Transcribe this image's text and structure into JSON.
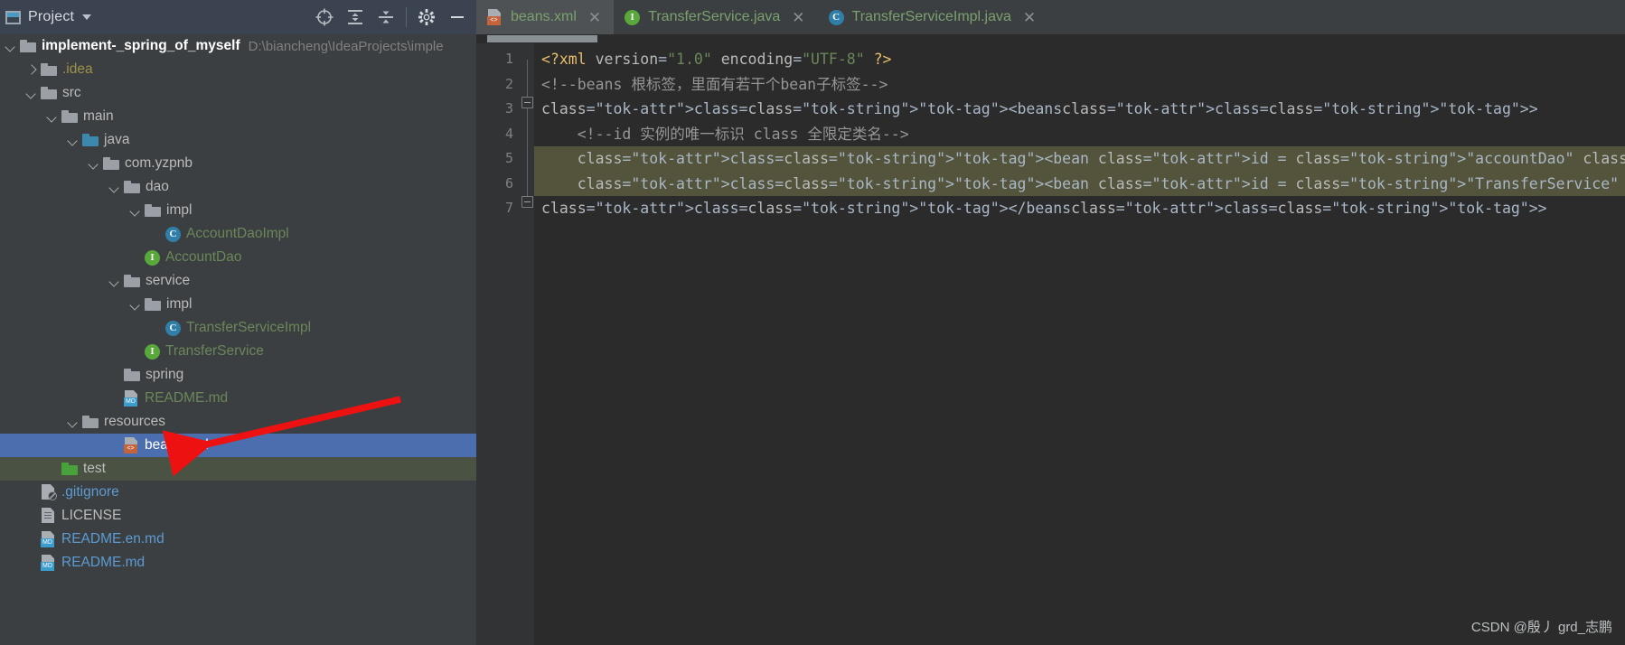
{
  "window": {
    "watermark": "CSDN @殷丿 grd_志鹏"
  },
  "project_panel": {
    "title": "Project",
    "title_icon": "project-panel-icon",
    "caret_icon": "chevron-down-icon",
    "toolbar": [
      {
        "name": "locate-icon",
        "label": ""
      },
      {
        "name": "expand-all-icon",
        "label": ""
      },
      {
        "name": "collapse-all-icon",
        "label": ""
      },
      {
        "name": "settings-gear-icon",
        "label": ""
      },
      {
        "name": "hide-panel-icon",
        "label": ""
      }
    ]
  },
  "tree": [
    {
      "label": "implement-_spring_of_myself",
      "path": "D:\\biancheng\\IdeaProjects\\imple",
      "indent": 0,
      "arrow": "down",
      "icon": "module-folder",
      "color": "white",
      "bold": true,
      "name": "tree-item-project-root"
    },
    {
      "label": ".idea",
      "path": "",
      "indent": 1,
      "arrow": "right",
      "icon": "folder-grey",
      "color": "yellow",
      "bold": false,
      "name": "tree-item-idea"
    },
    {
      "label": "src",
      "path": "",
      "indent": 1,
      "arrow": "down",
      "icon": "folder-grey",
      "color": "grey",
      "bold": false,
      "name": "tree-item-src"
    },
    {
      "label": "main",
      "path": "",
      "indent": 2,
      "arrow": "down",
      "icon": "folder-grey",
      "color": "grey",
      "bold": false,
      "name": "tree-item-main"
    },
    {
      "label": "java",
      "path": "",
      "indent": 3,
      "arrow": "down",
      "icon": "folder-blue",
      "color": "grey",
      "bold": false,
      "name": "tree-item-java"
    },
    {
      "label": "com.yzpnb",
      "path": "",
      "indent": 4,
      "arrow": "down",
      "icon": "folder-package",
      "color": "grey",
      "bold": false,
      "name": "tree-item-com-yzpnb"
    },
    {
      "label": "dao",
      "path": "",
      "indent": 5,
      "arrow": "down",
      "icon": "folder-package",
      "color": "grey",
      "bold": false,
      "name": "tree-item-dao"
    },
    {
      "label": "impl",
      "path": "",
      "indent": 6,
      "arrow": "down",
      "icon": "folder-package",
      "color": "grey",
      "bold": false,
      "name": "tree-item-dao-impl"
    },
    {
      "label": "AccountDaoImpl",
      "path": "",
      "indent": 7,
      "arrow": "none",
      "icon": "class-icon",
      "color": "green",
      "bold": false,
      "name": "tree-item-accountdaoimpl"
    },
    {
      "label": "AccountDao",
      "path": "",
      "indent": 6,
      "arrow": "none",
      "icon": "interface-icon",
      "color": "green",
      "bold": false,
      "name": "tree-item-accountdao"
    },
    {
      "label": "service",
      "path": "",
      "indent": 5,
      "arrow": "down",
      "icon": "folder-package",
      "color": "grey",
      "bold": false,
      "name": "tree-item-service"
    },
    {
      "label": "impl",
      "path": "",
      "indent": 6,
      "arrow": "down",
      "icon": "folder-package",
      "color": "grey",
      "bold": false,
      "name": "tree-item-service-impl"
    },
    {
      "label": "TransferServiceImpl",
      "path": "",
      "indent": 7,
      "arrow": "none",
      "icon": "class-icon",
      "color": "green",
      "bold": false,
      "name": "tree-item-transferserviceimpl"
    },
    {
      "label": "TransferService",
      "path": "",
      "indent": 6,
      "arrow": "none",
      "icon": "interface-icon",
      "color": "green",
      "bold": false,
      "name": "tree-item-transferservice"
    },
    {
      "label": "spring",
      "path": "",
      "indent": 5,
      "arrow": "none",
      "icon": "folder-package",
      "color": "grey",
      "bold": false,
      "name": "tree-item-spring"
    },
    {
      "label": "README.md",
      "path": "",
      "indent": 5,
      "arrow": "none",
      "icon": "markdown-icon",
      "color": "green",
      "bold": false,
      "name": "tree-item-readme-md-inner"
    },
    {
      "label": "resources",
      "path": "",
      "indent": 3,
      "arrow": "down",
      "icon": "folder-resources",
      "color": "grey",
      "bold": false,
      "name": "tree-item-resources"
    },
    {
      "label": "beans.xml",
      "path": "",
      "indent": 5,
      "arrow": "none",
      "icon": "xml-icon",
      "color": "white",
      "bold": false,
      "selected": true,
      "name": "tree-item-beans-xml"
    },
    {
      "label": "test",
      "path": "",
      "indent": 2,
      "arrow": "none",
      "icon": "folder-green",
      "color": "grey",
      "bold": false,
      "testscope": true,
      "name": "tree-item-test"
    },
    {
      "label": ".gitignore",
      "path": "",
      "indent": 1,
      "arrow": "none",
      "icon": "gitignore-icon",
      "color": "blue",
      "bold": false,
      "name": "tree-item-gitignore"
    },
    {
      "label": "LICENSE",
      "path": "",
      "indent": 1,
      "arrow": "none",
      "icon": "text-file-icon",
      "color": "grey",
      "bold": false,
      "name": "tree-item-license"
    },
    {
      "label": "README.en.md",
      "path": "",
      "indent": 1,
      "arrow": "none",
      "icon": "markdown-icon",
      "color": "blue",
      "bold": false,
      "name": "tree-item-readme-en-md"
    },
    {
      "label": "README.md",
      "path": "",
      "indent": 1,
      "arrow": "none",
      "icon": "markdown-icon",
      "color": "blue",
      "bold": false,
      "name": "tree-item-readme-md"
    }
  ],
  "tabs": [
    {
      "label": "beans.xml",
      "icon": "xml-icon",
      "active": true,
      "close": "✕",
      "name": "tab-beans-xml"
    },
    {
      "label": "TransferService.java",
      "icon": "interface-icon",
      "active": false,
      "close": "✕",
      "name": "tab-transferservice-java"
    },
    {
      "label": "TransferServiceImpl.java",
      "icon": "class-icon",
      "active": false,
      "close": "✕",
      "name": "tab-transferserviceimpl-java"
    }
  ],
  "editor": {
    "line_numbers": [
      "1",
      "2",
      "3",
      "4",
      "5",
      "6",
      "7"
    ],
    "lines": [
      {
        "n": "1",
        "text": "<?xml version=\"1.0\" encoding=\"UTF-8\" ?>",
        "highlight": false
      },
      {
        "n": "2",
        "text": "<!--beans 根标签，里面有若干个bean子标签-->",
        "highlight": false
      },
      {
        "n": "3",
        "text": "<beans>",
        "highlight": false
      },
      {
        "n": "4",
        "text": "    <!--id 实例的唯一标识 class 全限定类名-->",
        "highlight": false
      },
      {
        "n": "5",
        "text": "    <bean id = \"accountDao\" class=\"com.yzpnb.dao.impl.AccountDaoImpl\"></bean>",
        "highlight": true
      },
      {
        "n": "6",
        "text": "    <bean id = \"TransferService\" class=\"com.yzpnb.service.impl.TransferServiceImpl\"></bean>",
        "highlight": true
      },
      {
        "n": "7",
        "text": "</beans>",
        "highlight": false
      }
    ]
  },
  "annotation": {
    "arrow_color": "#ee1111",
    "points_to": "beans.xml"
  },
  "colors": {
    "panel_bg": "#3c3f41",
    "header_bg": "#3c4350",
    "editor_bg": "#2b2b2b",
    "gutter_bg": "#313335",
    "selection": "#4b6eaf",
    "test_scope": "#4a5343",
    "tab_active": "#4e5254",
    "code_highlight": "#53543b"
  }
}
